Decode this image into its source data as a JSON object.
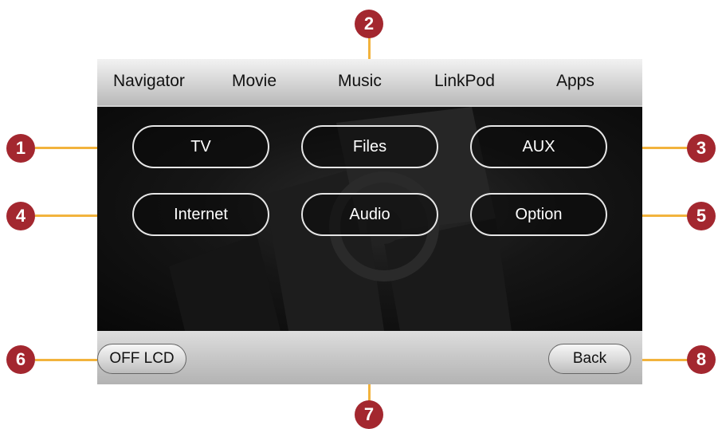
{
  "top_menu": {
    "items": [
      {
        "label": "Navigator"
      },
      {
        "label": "Movie"
      },
      {
        "label": "Music"
      },
      {
        "label": "LinkPod"
      },
      {
        "label": "Apps"
      }
    ]
  },
  "tiles": {
    "tv": "TV",
    "files": "Files",
    "aux": "AUX",
    "internet": "Internet",
    "audio": "Audio",
    "option": "Option"
  },
  "bottom_bar": {
    "off_lcd": "OFF LCD",
    "back": "Back"
  },
  "callouts": [
    "1",
    "2",
    "3",
    "4",
    "5",
    "6",
    "7",
    "8"
  ],
  "colors": {
    "callout_fill": "#a3272f",
    "leader_line": "#f2b33d",
    "tile_border": "#e6e6e6",
    "screen_background": "#0b0b0b"
  }
}
